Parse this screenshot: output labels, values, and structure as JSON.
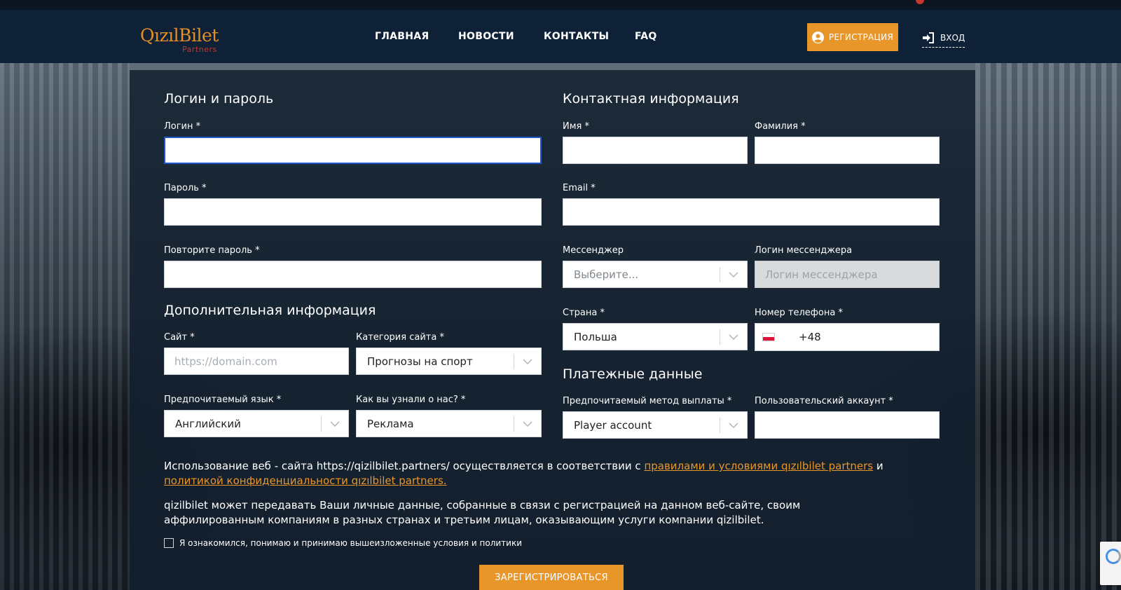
{
  "header": {
    "logo_main": "QızılBilet",
    "logo_sub": "Partners",
    "nav": [
      "ГЛАВНАЯ",
      "НОВОСТИ",
      "КОНТАКТЫ",
      "FAQ"
    ],
    "register_label": "РЕГИСТРАЦИЯ",
    "login_label": "ВХОД"
  },
  "login_section": {
    "title": "Логин и пароль",
    "login_label": "Логин *",
    "login_value": "",
    "password_label": "Пароль *",
    "password_repeat_label": "Повторите пароль *"
  },
  "extra_section": {
    "title": "Дополнительная информация",
    "site_label": "Сайт *",
    "site_placeholder": "https://domain.com",
    "category_label": "Категория сайта *",
    "category_value": "Прогнозы на спорт",
    "language_label": "Предпочитаемый язык *",
    "language_value": "Английский",
    "source_label": "Как вы узнали о нас? *",
    "source_value": "Реклама"
  },
  "contact_section": {
    "title": "Контактная информация",
    "first_name_label": "Имя *",
    "last_name_label": "Фамилия *",
    "email_label": "Email *",
    "messenger_label": "Мессенджер",
    "messenger_value": "Выберите...",
    "messenger_login_label": "Логин мессенджера",
    "messenger_login_placeholder": "Логин мессенджера",
    "country_label": "Страна *",
    "country_value": "Польша",
    "phone_label": "Номер телефона *",
    "phone_code": "+48"
  },
  "payment_section": {
    "title": "Платежные данные",
    "method_label": "Предпочитаемый метод выплаты *",
    "method_value": "Player account",
    "account_label": "Пользовательский аккаунт *"
  },
  "terms": {
    "line1_prefix": "Использование веб - сайта https://qizilbilet.partners/ осуществляется в соответствии с ",
    "link1": "правилами и условиями qızılbilet partners",
    "line1_suffix": " и",
    "link2": "политикой конфиденциальности qızılbilet partners.",
    "para2": "qizilbilet может передавать Ваши личные данные, собранные в связи с регистрацией на данном веб-сайте, своим аффилированным компаниям в разных странах и третьим лицам, оказывающим услуги компании qizilbilet.",
    "checkbox_label": "Я ознакомился, понимаю и принимаю вышеизложенные условия и политики"
  },
  "submit_label": "ЗАРЕГИСТРИРОВАТЬСЯ",
  "colors": {
    "accent": "#e8962a",
    "header_bg": "#0f2136",
    "focus": "#1f56c9"
  }
}
